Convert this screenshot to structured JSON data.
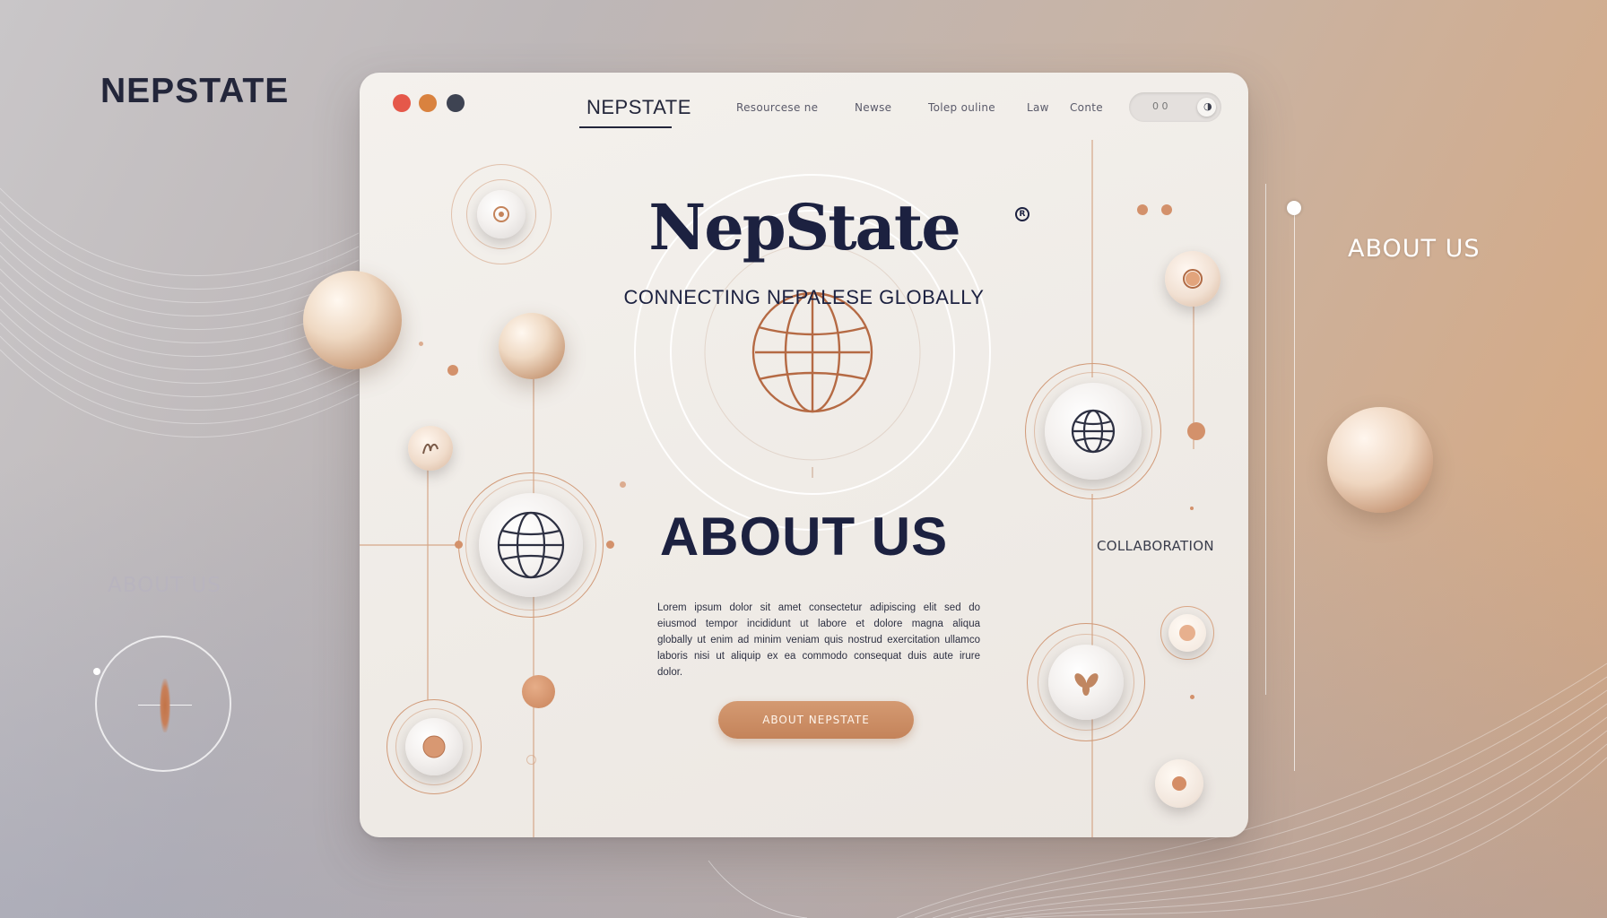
{
  "background": {
    "brand": "NEPSTATE",
    "about_right": "ABOUT US",
    "about_left": "ABOUT US"
  },
  "window": {
    "controls": [
      "close",
      "minimize",
      "maximize"
    ]
  },
  "nav": {
    "brand": "NEPSTATE",
    "links": [
      "Resourcese ne",
      "Newse",
      "Tolep ouline",
      "Law",
      "Conte"
    ],
    "toggle_label": "0 0"
  },
  "hero": {
    "title": "NepState",
    "registered_mark": "R",
    "subtitle": "CONNECTING NEPALESE GLOBALLY",
    "icon": "globe-icon"
  },
  "about": {
    "title": "ABOUT US",
    "side_label": "COLLABORATION",
    "body": "Lorem ipsum dolor sit amet consectetur adipiscing elit sed do eiusmod tempor incididunt ut labore et dolore magna aliqua globally ut enim ad minim veniam quis nostrud exercitation ullamco laboris nisi ut aliquip ex ea commodo consequat duis aute irure dolor.",
    "cta_label": "ABOUT NEPSTATE"
  },
  "colors": {
    "navy": "#1c2140",
    "accent": "#c4835a",
    "card": "#f1eeea",
    "red": "#e5584a",
    "orange": "#d9823f"
  },
  "icons": [
    "globe-icon",
    "compass-icon",
    "signature-icon",
    "leaf-icon",
    "pin-icon"
  ]
}
